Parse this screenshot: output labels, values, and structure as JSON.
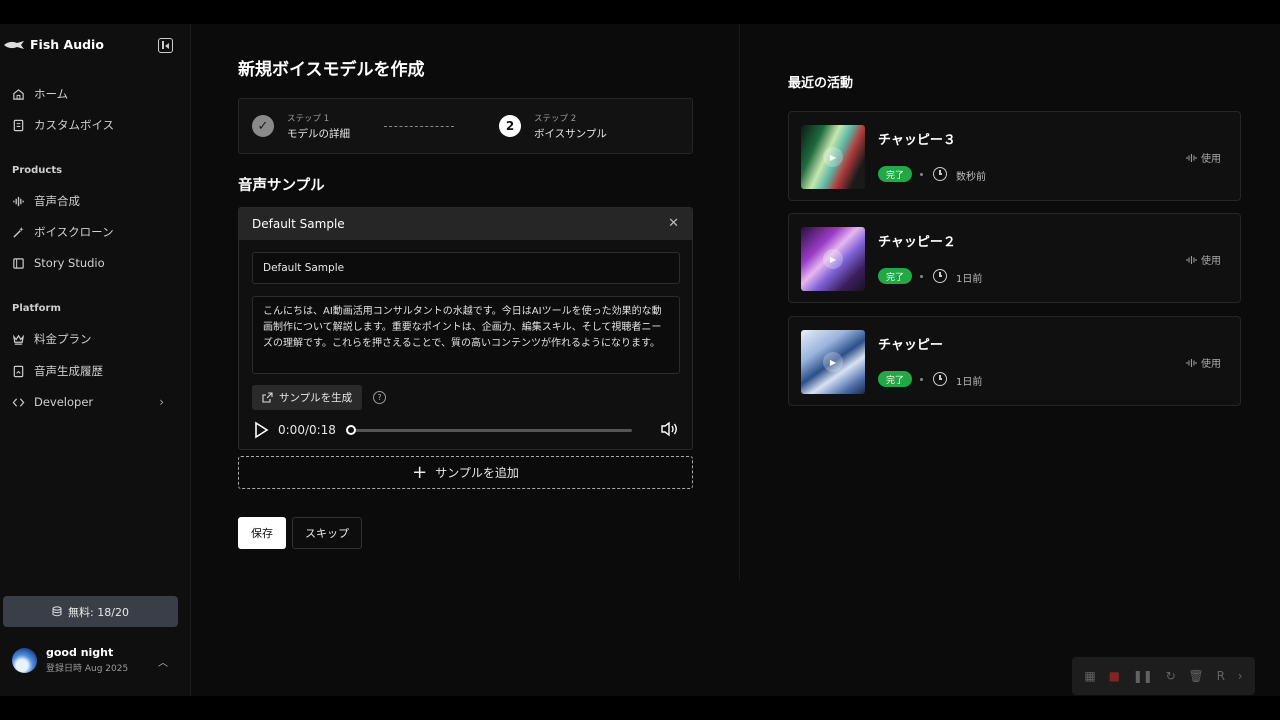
{
  "sidebar": {
    "logo": "Fish Audio",
    "nav_top": [
      {
        "label": "ホーム",
        "icon": "home-icon"
      },
      {
        "label": "カスタムボイス",
        "icon": "document-icon"
      }
    ],
    "section_products": "Products",
    "nav_products": [
      {
        "label": "音声合成",
        "icon": "waveform-icon"
      },
      {
        "label": "ボイスクローン",
        "icon": "magic-wand-icon"
      },
      {
        "label": "Story Studio",
        "icon": "book-icon"
      }
    ],
    "section_platform": "Platform",
    "nav_platform": [
      {
        "label": "料金プラン",
        "icon": "crown-icon"
      },
      {
        "label": "音声生成履歴",
        "icon": "history-icon"
      },
      {
        "label": "Developer",
        "icon": "code-icon"
      }
    ],
    "quota": "無料: 18/20",
    "user_name": "good night",
    "user_sub": "登録日時 Aug 2025"
  },
  "main": {
    "title": "新規ボイスモデルを作成",
    "steps": [
      {
        "small": "ステップ 1",
        "label": "モデルの詳細",
        "status": "completed"
      },
      {
        "small": "ステップ 2",
        "label": "ボイスサンプル",
        "number": "2",
        "status": "active"
      }
    ],
    "section_title": "音声サンプル",
    "sample": {
      "header": "Default Sample",
      "name_value": "Default Sample",
      "text": "こんにちは、AI動画活用コンサルタントの水越です。今日はAIツールを使った効果的な動画制作について解説します。重要なポイントは、企画力、編集スキル、そして視聴者ニーズの理解です。これらを押さえることで、質の高いコンテンツが作れるようになります。",
      "generate_label": "サンプルを生成",
      "time": "0:00/0:18",
      "progress": 0
    },
    "add_label": "サンプルを追加",
    "save_label": "保存",
    "skip_label": "スキップ"
  },
  "recent": {
    "title": "最近の活動",
    "items": [
      {
        "name": "チャッピー３",
        "status": "完了",
        "time": "数秒前",
        "use": "使用"
      },
      {
        "name": "チャッピー２",
        "status": "完了",
        "time": "1日前",
        "use": "使用"
      },
      {
        "name": "チャッピー",
        "status": "完了",
        "time": "1日前",
        "use": "使用"
      }
    ]
  },
  "colors": {
    "accent_green": "#22a845",
    "background": "#0b0b0b",
    "card": "#101010"
  }
}
